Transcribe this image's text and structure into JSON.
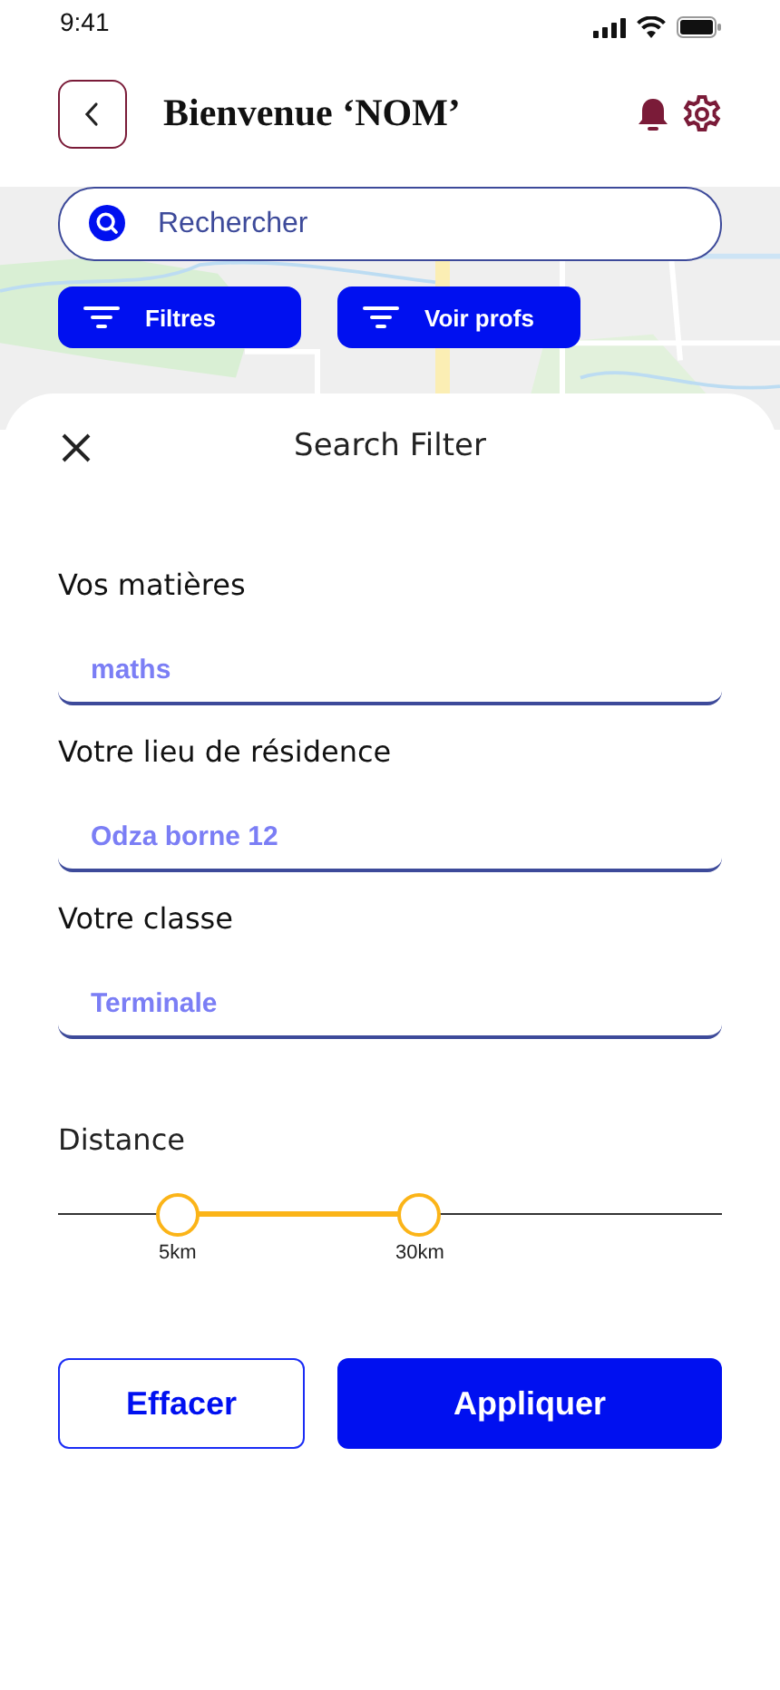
{
  "status_bar": {
    "time": "9:41"
  },
  "header": {
    "title": "Bienvenue ‘NOM’"
  },
  "search": {
    "placeholder": "Rechercher"
  },
  "map_buttons": [
    {
      "label": "Filtres"
    },
    {
      "label": "Voir profs"
    }
  ],
  "sheet": {
    "title": "Search Filter",
    "fields": [
      {
        "label": "Vos matières",
        "value": "maths"
      },
      {
        "label": "Votre lieu de résidence",
        "value": "Odza borne 12"
      },
      {
        "label": "Votre classe",
        "value": "Terminale"
      }
    ],
    "distance": {
      "label": "Distance",
      "thumbs": [
        {
          "level": 0.18,
          "reading": "5km"
        },
        {
          "level": 0.545,
          "reading": "30km"
        }
      ]
    },
    "buttons": [
      {
        "label": "Effacer",
        "kind": "secondary"
      },
      {
        "label": "Appliquer",
        "kind": "primary"
      }
    ]
  }
}
